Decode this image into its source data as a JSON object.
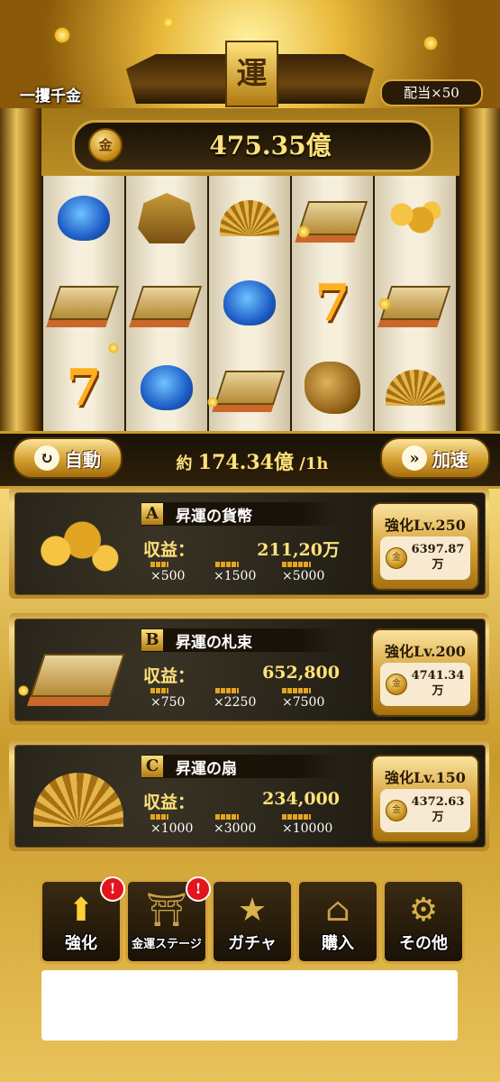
{
  "header": {
    "title": "一攫千金",
    "plaque_char": "運",
    "multiplier": "配当×50",
    "coin_symbol": "金",
    "total_coins": "475.35億"
  },
  "reels": {
    "columns": [
      [
        "turtle",
        "money-stack",
        "seven"
      ],
      [
        "treasure-ship",
        "money-stack",
        "turtle"
      ],
      [
        "folding-fan",
        "turtle",
        "money-stack"
      ],
      [
        "money-stack",
        "seven",
        "dragon"
      ],
      [
        "gold-coins",
        "money-stack",
        "folding-fan"
      ]
    ]
  },
  "controls": {
    "auto_label": "自動",
    "speed_label": "加速",
    "rate_prefix": "約",
    "rate_value": "174.34億",
    "rate_suffix": "/1h"
  },
  "cards": [
    {
      "letter": "A",
      "name": "昇運の貨幣",
      "income_label": "収益：",
      "income": "211,20万",
      "multipliers": [
        "×500",
        "×1500",
        "×5000"
      ],
      "upgrade_label": "強化Lv.250",
      "cost_line1": "6397.87",
      "cost_line2": "万",
      "art": "gold-coins"
    },
    {
      "letter": "B",
      "name": "昇運の札束",
      "income_label": "収益：",
      "income": "652,800",
      "multipliers": [
        "×750",
        "×2250",
        "×7500"
      ],
      "upgrade_label": "強化Lv.200",
      "cost_line1": "4741.34",
      "cost_line2": "万",
      "art": "money-stack"
    },
    {
      "letter": "C",
      "name": "昇運の扇",
      "income_label": "収益：",
      "income": "234,000",
      "multipliers": [
        "×1000",
        "×3000",
        "×10000"
      ],
      "upgrade_label": "強化Lv.150",
      "cost_line1": "4372.63",
      "cost_line2": "万",
      "art": "folding-fan"
    }
  ],
  "nav": [
    {
      "label": "強化",
      "icon": "arrow-up-icon",
      "badge": "!"
    },
    {
      "label": "金運ステージ",
      "icon": "torii-icon",
      "badge": "!"
    },
    {
      "label": "ガチャ",
      "icon": "star-medal-icon",
      "badge": ""
    },
    {
      "label": "購入",
      "icon": "lantern-icon",
      "badge": ""
    },
    {
      "label": "その他",
      "icon": "gear-box-icon",
      "badge": ""
    }
  ],
  "colors": {
    "gold": "#ffe27a",
    "dark": "#1a1206",
    "badge_red": "#e3141b"
  }
}
